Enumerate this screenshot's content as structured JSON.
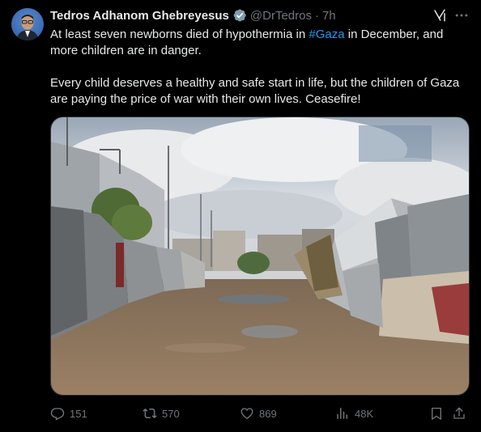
{
  "author": {
    "name": "Tedros Adhanom Ghebreyesus",
    "handle": "@DrTedros",
    "separator": "·",
    "time": "7h",
    "verified": true,
    "avatar_icon": "profile-photo"
  },
  "tweet": {
    "line1_before": "At least seven newborns died of hypothermia in ",
    "hashtag": "#Gaza",
    "line1_after": " in December, and more children are in danger.",
    "paragraph2": "Every child deserves a healthy and safe start in life, but the children of Gaza are paying the price of war with their own lives. Ceasefire!"
  },
  "media": {
    "type": "photo",
    "description_icon": "photo-of-camp-tents"
  },
  "actions": {
    "replies": "151",
    "reposts": "570",
    "likes": "869",
    "views": "48K"
  },
  "colors": {
    "background": "#000000",
    "text": "#e7e9ea",
    "muted": "#71767b",
    "accent": "#1d9bf0",
    "border": "#2f3336"
  }
}
